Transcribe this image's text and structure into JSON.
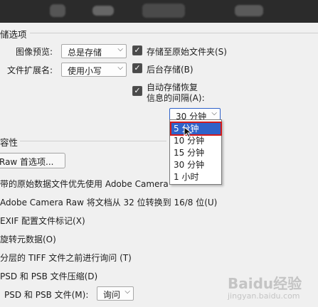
{
  "section_save": {
    "title": "储选项"
  },
  "image_preview": {
    "label": "图像预览:",
    "value": "总是存储"
  },
  "file_ext": {
    "label": "文件扩展名:",
    "value": "使用小写"
  },
  "save_to_original": {
    "label": "存储至原始文件夹(S)",
    "checked": true
  },
  "background_save": {
    "label": "后台存储(B)",
    "checked": true
  },
  "auto_save": {
    "label_line1": "自动存储恢复",
    "label_line2": "信息的间隔(A):",
    "checked": true
  },
  "interval": {
    "value": "30 分钟",
    "options": [
      "5 分钟",
      "10 分钟",
      "15 分钟",
      "30 分钟",
      "1 小时"
    ],
    "highlighted": "5 分钟"
  },
  "section_compat": {
    "title": "容性"
  },
  "camera_raw_btn": {
    "label": "Raw 首选项..."
  },
  "compat_lines": [
    "带的原始数据文件优先使用 Adobe Camera",
    "Adobe Camera Raw 将文档从 32 位转换到 16/8 位(U)",
    "EXIF 配置文件标记(X)",
    "旋转元数据(O)",
    "分层的 TIFF 文件之前进行询问 (T)",
    "PSD 和 PSB 文件压缩(D)"
  ],
  "maximize_psd": {
    "label": "PSD 和 PSB 文件(M):",
    "value": "询问"
  },
  "watermark": {
    "text": "Baidu经验",
    "sub": "jingyan.baidu.com"
  },
  "colors": {
    "accent": "#2f62c9",
    "highlight_border": "#d41a1a",
    "topbar": "#2b2b2b"
  }
}
